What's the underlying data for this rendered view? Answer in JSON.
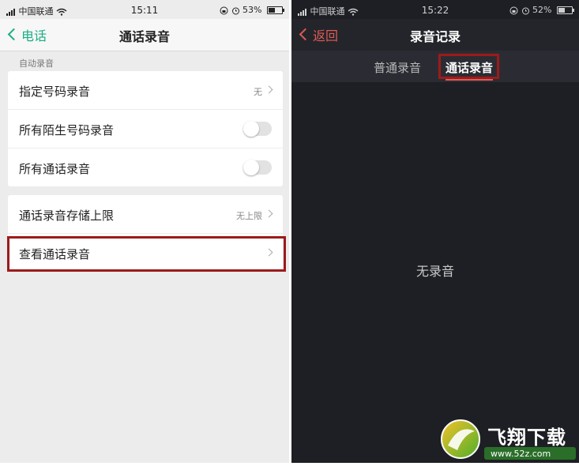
{
  "left": {
    "status": {
      "carrier": "中国联通",
      "time": "15:11",
      "battery": "53%",
      "battery_level": 0.53
    },
    "nav": {
      "back": "电话",
      "title": "通话录音"
    },
    "section_title": "自动录音",
    "group1": [
      {
        "label": "指定号码录音",
        "value": "无"
      },
      {
        "label": "所有陌生号码录音",
        "toggle": false
      },
      {
        "label": "所有通话录音",
        "toggle": false
      }
    ],
    "group2": [
      {
        "label": "通话录音存储上限",
        "value": "无上限"
      },
      {
        "label": "查看通话录音"
      }
    ]
  },
  "right": {
    "status": {
      "carrier": "中国联通",
      "time": "15:22",
      "battery": "52%",
      "battery_level": 0.52
    },
    "nav": {
      "back": "返回",
      "title": "录音记录"
    },
    "tabs": [
      "普通录音",
      "通话录音"
    ],
    "active_tab": 1,
    "empty_text": "无录音"
  },
  "watermark": {
    "brand": "飞翔下载",
    "url": "www.52z.com"
  },
  "colors": {
    "accent_green": "#1aae86",
    "accent_red": "#e05a55",
    "highlight": "#9b1b1b",
    "dark_bg": "#1e1f24"
  }
}
